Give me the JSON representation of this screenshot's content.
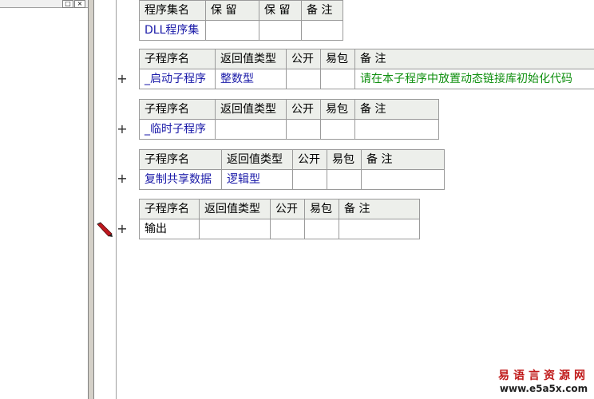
{
  "assembly_table": {
    "headers": [
      "程序集名",
      "保 留",
      "保 留",
      "备 注"
    ],
    "row": [
      "DLL程序集",
      "",
      "",
      ""
    ]
  },
  "subprograms": [
    {
      "headers": [
        "子程序名",
        "返回值类型",
        "公开",
        "易包",
        "备 注"
      ],
      "row": [
        "_启动子程序",
        "整数型",
        "",
        "",
        "请在本子程序中放置动态链接库初始化代码"
      ],
      "expander": "+"
    },
    {
      "headers": [
        "子程序名",
        "返回值类型",
        "公开",
        "易包",
        "备 注"
      ],
      "row": [
        "_临时子程序",
        "",
        "",
        "",
        ""
      ],
      "expander": "+"
    },
    {
      "headers": [
        "子程序名",
        "返回值类型",
        "公开",
        "易包",
        "备 注"
      ],
      "row": [
        "复制共享数据",
        "逻辑型",
        "",
        "",
        ""
      ],
      "expander": "+"
    },
    {
      "headers": [
        "子程序名",
        "返回值类型",
        "公开",
        "易包",
        "备 注"
      ],
      "row": [
        "输出",
        "",
        "",
        "",
        ""
      ],
      "expander": "+"
    }
  ],
  "window_buttons": {
    "restore": "□",
    "close": "×"
  },
  "icons": {
    "edit_marker": "pencil-icon"
  },
  "watermark": {
    "site_name": "易语言资源网",
    "url": "www.e5a5x.com"
  },
  "colors": {
    "header_bg": "#edefeb",
    "name_text": "#1a1aa8",
    "comment_text": "#0f8f0f",
    "watermark": "#c01a1a"
  }
}
